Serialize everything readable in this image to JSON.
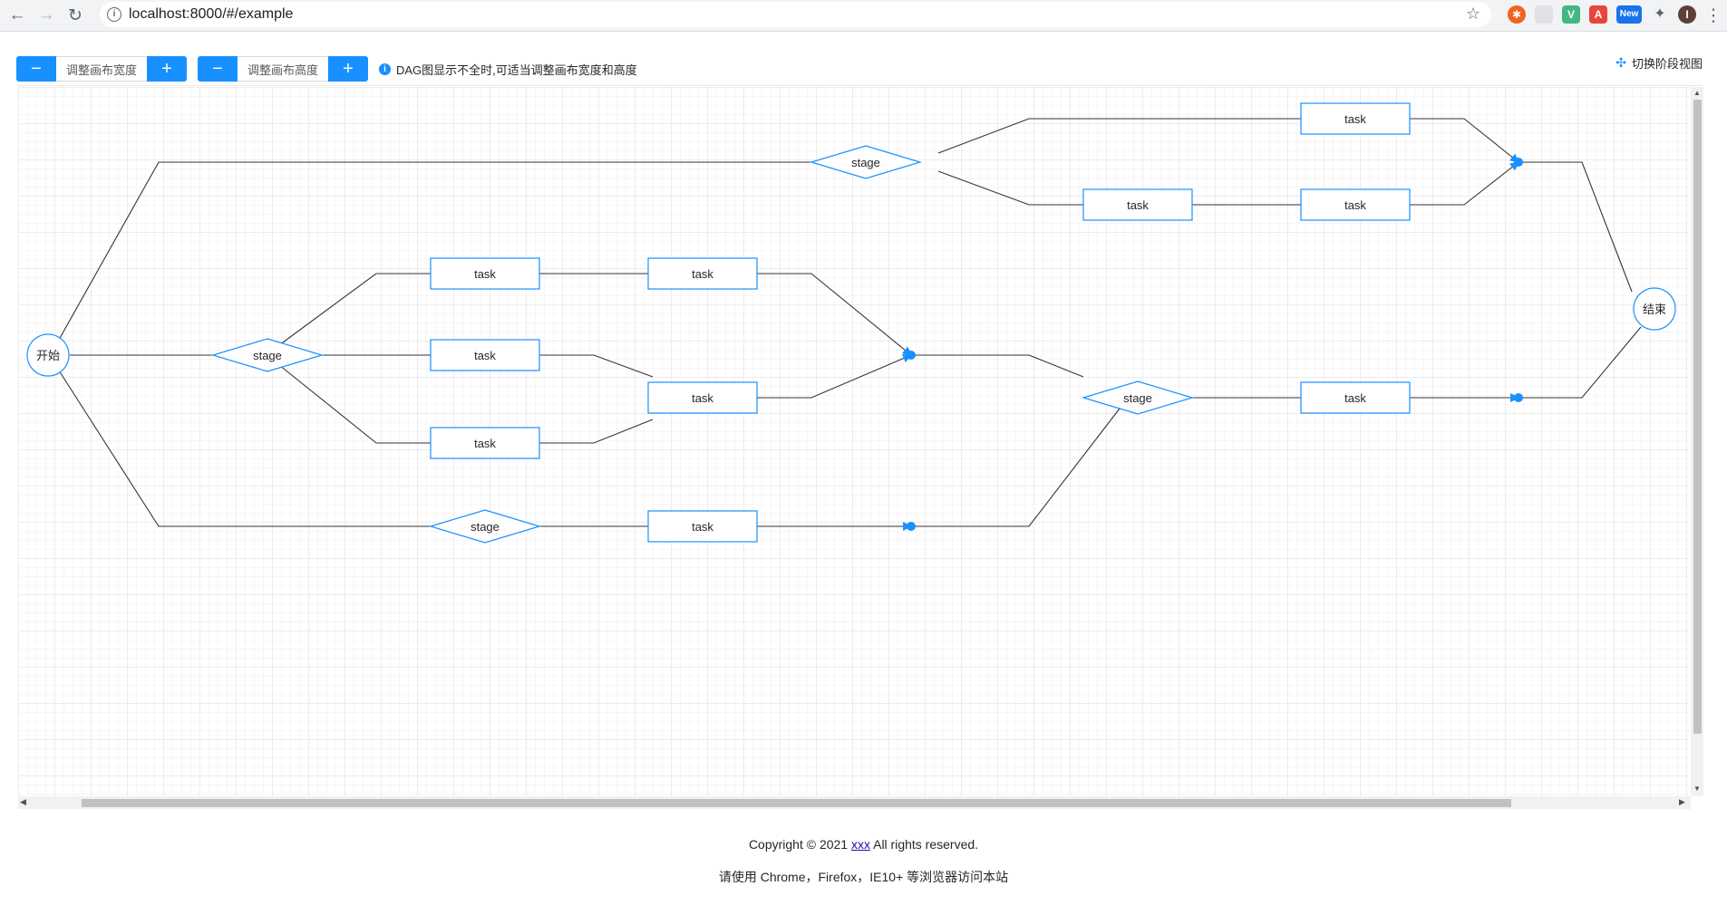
{
  "browser": {
    "url": "localhost:8000/#/example",
    "back_icon": "arrow-left",
    "forward_icon": "arrow-right",
    "reload_icon": "reload",
    "info_icon": "i",
    "extensions": [
      {
        "name": "extension-orange",
        "color": "#f0641e",
        "glyph": "✱"
      },
      {
        "name": "extension-grey",
        "color": "#dfe1e5",
        "glyph": ""
      },
      {
        "name": "extension-vue",
        "color": "#41b883",
        "glyph": "V"
      },
      {
        "name": "extension-red",
        "color": "#e8453c",
        "glyph": "A"
      },
      {
        "name": "extension-new",
        "color": "#1a73e8",
        "glyph": "New"
      },
      {
        "name": "extension-puzzle",
        "color": "#5f6368",
        "glyph": "✦"
      },
      {
        "name": "profile-avatar",
        "color": "#5d4037",
        "glyph": "I"
      }
    ]
  },
  "toolbar": {
    "width_label": "调整画布宽度",
    "height_label": "调整画布高度",
    "minus": "−",
    "plus": "+",
    "hint_text": "DAG图显示不全时,可适当调整画布宽度和高度",
    "switch_label": "切换阶段视图"
  },
  "graph": {
    "accent_color": "#1890ff",
    "edge_color": "#333333",
    "start_label": "开始",
    "end_label": "结束",
    "stage_label": "stage",
    "task_label": "task"
  },
  "footer": {
    "copyright_prefix": "Copyright © 2021 ",
    "copyright_link": "xxx",
    "copyright_suffix": " All rights reserved.",
    "browser_notice": "请使用 Chrome，Firefox，IE10+ 等浏览器访问本站"
  }
}
